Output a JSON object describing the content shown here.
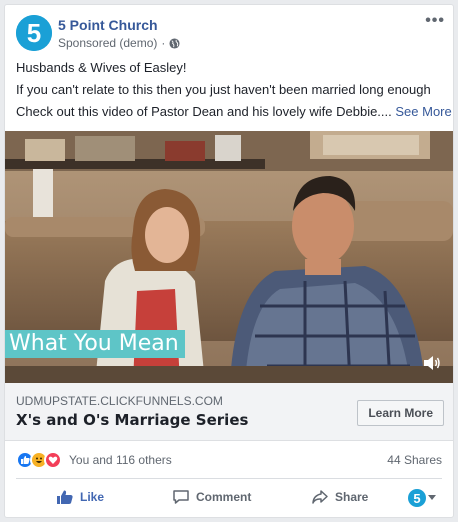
{
  "post": {
    "page_name": "5 Point Church",
    "sponsored": "Sponsored (demo)",
    "separator": "·",
    "more_menu": "•••",
    "lines": [
      "Husbands & Wives of Easley!",
      "If you can't relate to this then you just haven't been married long enough",
      "Check out this video of Pastor Dean and his lovely wife Debbie.... "
    ],
    "see_more": "See More"
  },
  "video": {
    "caption": "What You Mean"
  },
  "link": {
    "domain": "UDMUPSTATE.CLICKFUNNELS.COM",
    "title": "X's and O's Marriage Series",
    "cta": "Learn More"
  },
  "stats": {
    "reactions_text": "You and 116 others",
    "shares": "44 Shares"
  },
  "actions": {
    "like": "Like",
    "comment": "Comment",
    "share": "Share"
  },
  "colors": {
    "brand": "#1aa0d6",
    "link": "#365899",
    "caption_bg": "#5ec5c7",
    "like_blue": "#4267b2"
  }
}
